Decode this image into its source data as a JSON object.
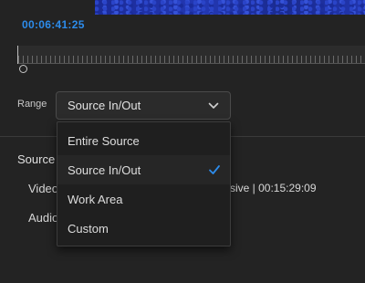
{
  "header": {
    "timecode": "00:06:41:25"
  },
  "range": {
    "label": "Range",
    "selected": "Source In/Out",
    "options": [
      {
        "label": "Entire Source"
      },
      {
        "label": "Source In/Out",
        "checked": true
      },
      {
        "label": "Work Area"
      },
      {
        "label": "Custom"
      }
    ]
  },
  "source": {
    "heading": "Source",
    "video_label": "Video",
    "video_info": "ssive | 00:15:29:09",
    "audio_label": "Audio"
  },
  "colors": {
    "accent": "#2d8ceb",
    "background": "#232323",
    "menu_background": "#1f1f1f"
  }
}
